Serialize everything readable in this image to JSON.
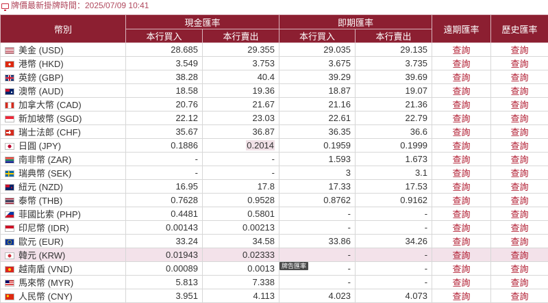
{
  "header": {
    "title": "牌價最新掛牌時間：2025/07/09 10:41"
  },
  "table": {
    "col_currency": "幣別",
    "group_cash": "現金匯率",
    "group_spot": "即期匯率",
    "col_forward": "遠期匯率",
    "col_history": "歷史匯率",
    "col_buy": "本行買入",
    "col_sell": "本行賣出",
    "link_label": "查詢",
    "rows": [
      {
        "flag": "us",
        "name": "美金 (USD)",
        "cash_buy": "28.685",
        "cash_sell": "29.355",
        "spot_buy": "29.035",
        "spot_sell": "29.135"
      },
      {
        "flag": "hk",
        "name": "港幣 (HKD)",
        "cash_buy": "3.549",
        "cash_sell": "3.753",
        "spot_buy": "3.675",
        "spot_sell": "3.735"
      },
      {
        "flag": "gb",
        "name": "英鎊 (GBP)",
        "cash_buy": "38.28",
        "cash_sell": "40.4",
        "spot_buy": "39.29",
        "spot_sell": "39.69"
      },
      {
        "flag": "au",
        "name": "澳幣 (AUD)",
        "cash_buy": "18.58",
        "cash_sell": "19.36",
        "spot_buy": "18.87",
        "spot_sell": "19.07"
      },
      {
        "flag": "ca",
        "name": "加拿大幣 (CAD)",
        "cash_buy": "20.76",
        "cash_sell": "21.67",
        "spot_buy": "21.16",
        "spot_sell": "21.36"
      },
      {
        "flag": "sg",
        "name": "新加坡幣 (SGD)",
        "cash_buy": "22.12",
        "cash_sell": "23.03",
        "spot_buy": "22.61",
        "spot_sell": "22.79"
      },
      {
        "flag": "ch",
        "name": "瑞士法郎 (CHF)",
        "cash_buy": "35.67",
        "cash_sell": "36.87",
        "spot_buy": "36.35",
        "spot_sell": "36.6"
      },
      {
        "flag": "jp",
        "name": "日圓 (JPY)",
        "cash_buy": "0.1886",
        "cash_sell": "0.2014",
        "spot_buy": "0.1959",
        "spot_sell": "0.1999"
      },
      {
        "flag": "za",
        "name": "南非幣 (ZAR)",
        "cash_buy": "-",
        "cash_sell": "-",
        "spot_buy": "1.593",
        "spot_sell": "1.673"
      },
      {
        "flag": "se",
        "name": "瑞典幣 (SEK)",
        "cash_buy": "-",
        "cash_sell": "-",
        "spot_buy": "3",
        "spot_sell": "3.1"
      },
      {
        "flag": "nz",
        "name": "紐元 (NZD)",
        "cash_buy": "16.95",
        "cash_sell": "17.8",
        "spot_buy": "17.33",
        "spot_sell": "17.53"
      },
      {
        "flag": "th",
        "name": "泰幣 (THB)",
        "cash_buy": "0.7628",
        "cash_sell": "0.9528",
        "spot_buy": "0.8762",
        "spot_sell": "0.9162"
      },
      {
        "flag": "ph",
        "name": "菲國比索 (PHP)",
        "cash_buy": "0.4481",
        "cash_sell": "0.5801",
        "spot_buy": "-",
        "spot_sell": "-"
      },
      {
        "flag": "id",
        "name": "印尼幣 (IDR)",
        "cash_buy": "0.00143",
        "cash_sell": "0.00213",
        "spot_buy": "-",
        "spot_sell": "-"
      },
      {
        "flag": "eu",
        "name": "歐元 (EUR)",
        "cash_buy": "33.24",
        "cash_sell": "34.58",
        "spot_buy": "33.86",
        "spot_sell": "34.26"
      },
      {
        "flag": "kr",
        "name": "韓元 (KRW)",
        "cash_buy": "0.01943",
        "cash_sell": "0.02333",
        "spot_buy": "-",
        "spot_sell": "-"
      },
      {
        "flag": "vn",
        "name": "越南盾 (VND)",
        "cash_buy": "0.00089",
        "cash_sell": "0.0013",
        "spot_buy": "-",
        "spot_sell": "-"
      },
      {
        "flag": "my",
        "name": "馬來幣 (MYR)",
        "cash_buy": "5.813",
        "cash_sell": "7.338",
        "spot_buy": "-",
        "spot_sell": "-"
      },
      {
        "flag": "cn",
        "name": "人民幣 (CNY)",
        "cash_buy": "3.951",
        "cash_sell": "4.113",
        "spot_buy": "4.023",
        "spot_sell": "4.073"
      }
    ]
  },
  "tooltip": "牌告匯率",
  "colors": {
    "header_bg": "#8c1f31",
    "link": "#b01a2f",
    "highlight_row": "#f3e2ea"
  }
}
